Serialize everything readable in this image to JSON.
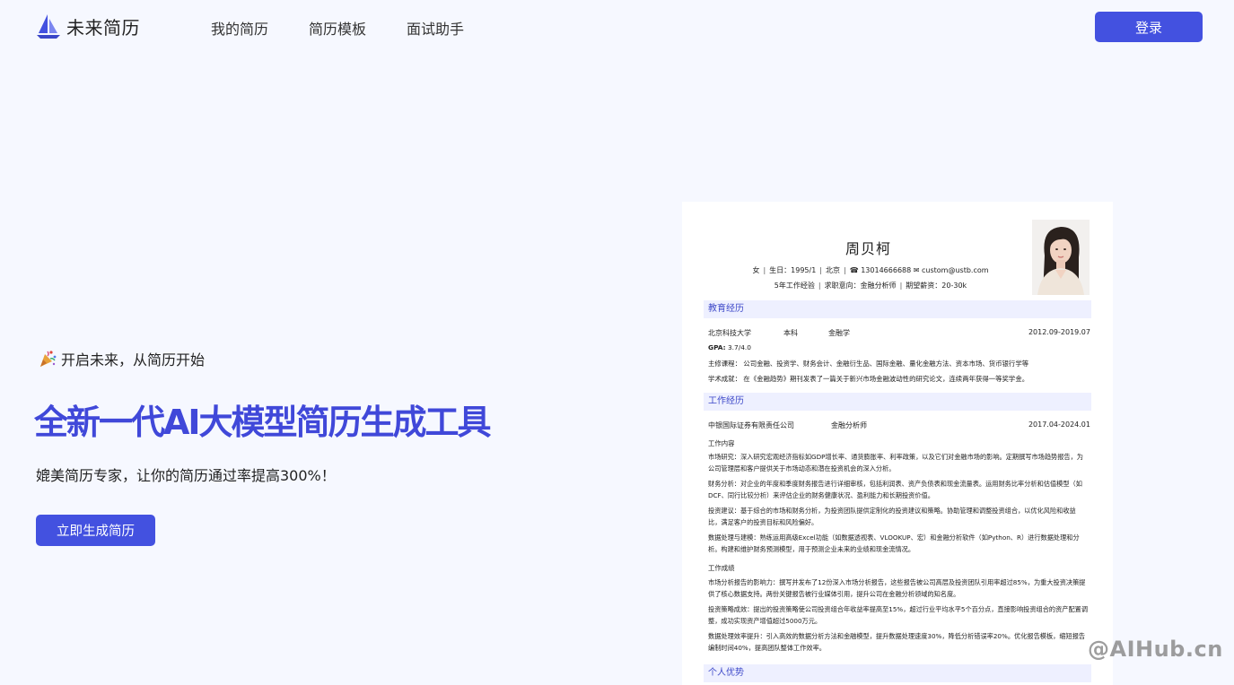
{
  "header": {
    "brand": "未来简历",
    "nav": [
      "我的简历",
      "简历模板",
      "面试助手"
    ],
    "login_label": "登录"
  },
  "hero": {
    "kicker": "开启未来，从简历开始",
    "title": "全新一代AI大模型简历生成工具",
    "subtitle": "媲美简历专家，让你的简历通过率提高300%！",
    "cta_label": "立即生成简历"
  },
  "resume": {
    "name": "周贝柯",
    "gender": "女",
    "birth": "生日：1995/1",
    "city": "北京",
    "phone": "13014666688",
    "email": "custom@ustb.com",
    "experience": "5年工作经验",
    "intent": "求职意向：金融分析师",
    "salary": "期望薪资：20-30k",
    "edu_heading": "教育经历",
    "school": "北京科技大学",
    "degree": "本科",
    "major": "金融学",
    "edu_period": "2012.09-2019.07",
    "gpa_label": "GPA:",
    "gpa_value": "3.7/4.0",
    "courses": "主修课程： 公司金融、投资学、财务会计、金融衍生品、国际金融、量化金融方法、资本市场、货币银行学等",
    "academic": "学术成就： 在《金融趋势》期刊发表了一篇关于新兴市场金融波动性的研究论文，连续两年获得一等奖学金。",
    "work_heading": "工作经历",
    "company": "中银国际证券有限责任公司",
    "position": "金融分析师",
    "work_period": "2017.04-2024.01",
    "content_label": "工作内容",
    "duties": [
      "市场研究：深入研究宏观经济指标如GDP增长率、通货膨胀率、利率政策，以及它们对金融市场的影响。定期撰写市场趋势报告，为公司管理层和客户提供关于市场动态和潜在投资机会的深入分析。",
      "财务分析：对企业的年度和季度财务报告进行详细审核，包括利润表、资产负债表和现金流量表。运用财务比率分析和估值模型（如DCF、同行比较分析）来评估企业的财务健康状况、盈利能力和长期投资价值。",
      "投资建议：基于综合的市场和财务分析，为投资团队提供定制化的投资建议和策略。协助管理和调整投资组合，以优化风险和收益比，满足客户的投资目标和风险偏好。",
      "数据处理与建模：熟练运用高级Excel功能（如数据透视表、VLOOKUP、宏）和金融分析软件（如Python、R）进行数据处理和分析。构建和维护财务预测模型，用于预测企业未来的业绩和现金流情况。"
    ],
    "results_label": "工作成绩",
    "results": [
      "市场分析报告的影响力：撰写并发布了12份深入市场分析报告，这些报告被公司高层及投资团队引用率超过85%，为重大投资决策提供了核心数据支持。两份关键报告被行业媒体引用，提升公司在金融分析领域的知名度。",
      "投资策略成效：提出的投资策略使公司投资组合年收益率提高至15%，超过行业平均水平5个百分点，直接影响投资组合的资产配置调整，成功实现资产增值超过5000万元。",
      "数据处理效率提升：引入高效的数据分析方法和金融模型，提升数据处理速度30%，降低分析错误率20%。优化报告模板，缩短报告编制时间40%，提高团队整体工作效率。"
    ],
    "advantage_heading": "个人优势"
  },
  "watermark": "@AIHub.cn",
  "colors": {
    "accent": "#4351e0",
    "title": "#4048d9",
    "background": "#f6f8ff",
    "section_bg": "#eef0ff"
  },
  "icons": {
    "logo": "sailboat-icon",
    "kicker": "party-popper-icon",
    "phone": "phone-icon",
    "email": "envelope-icon"
  }
}
